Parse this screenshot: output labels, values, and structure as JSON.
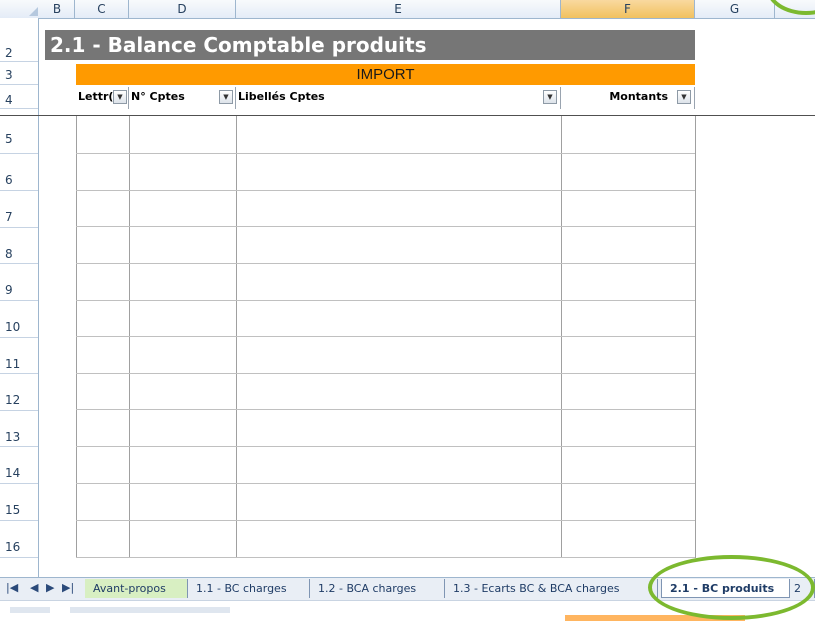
{
  "columns": [
    "B",
    "C",
    "D",
    "E",
    "F",
    "G"
  ],
  "rows": [
    "2",
    "3",
    "4",
    "5",
    "6",
    "7",
    "8",
    "9",
    "10",
    "11",
    "12",
    "13",
    "14",
    "15",
    "16"
  ],
  "title": "2.1 - Balance Comptable produits",
  "banner": "IMPORT",
  "table_headers": [
    "Lettr(",
    "N° Cptes",
    "Libellés Cptes",
    "Montants"
  ],
  "sheet_tabs": [
    "Avant-propos",
    "1.1 - BC charges",
    "1.2 - BCA charges",
    "1.3 - Ecarts BC & BCA charges",
    "2.1 - BC produits",
    "2"
  ],
  "active_tab": "2.1 - BC produits",
  "colors": {
    "title_bg": "#767676",
    "banner_bg": "#ff9a00",
    "highlight_ring": "#7cb92f",
    "first_tab": "#d8efc2"
  },
  "icons": {
    "filter": "filter-dropdown-icon",
    "nav": [
      "first-sheet-icon",
      "prev-sheet-icon",
      "next-sheet-icon",
      "last-sheet-icon"
    ]
  }
}
